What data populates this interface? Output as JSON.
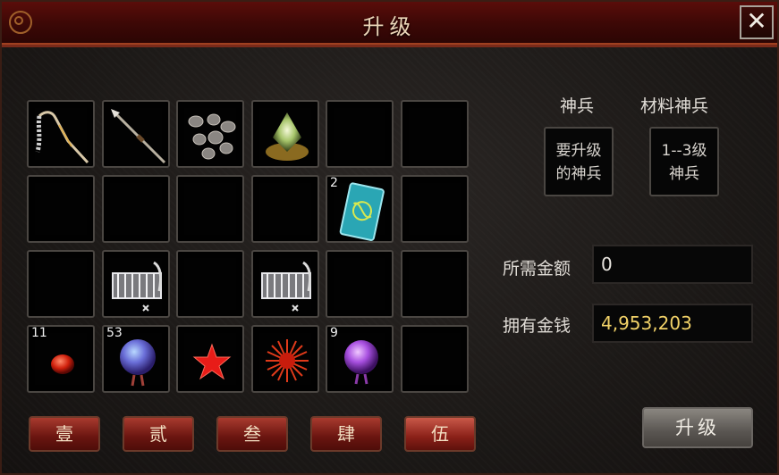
{
  "window": {
    "title": "升级",
    "close_label": "✕"
  },
  "inventory": {
    "rows": [
      [
        {
          "icon": "chain-whip-icon",
          "count": ""
        },
        {
          "icon": "spear-icon",
          "count": ""
        },
        {
          "icon": "ore-stones-icon",
          "count": ""
        },
        {
          "icon": "glowing-gem-icon",
          "count": ""
        },
        {
          "icon": "",
          "count": ""
        },
        {
          "icon": "",
          "count": ""
        }
      ],
      [
        {
          "icon": "",
          "count": ""
        },
        {
          "icon": "",
          "count": ""
        },
        {
          "icon": "",
          "count": ""
        },
        {
          "icon": "",
          "count": ""
        },
        {
          "icon": "jade-card-icon",
          "count": "2"
        },
        {
          "icon": "",
          "count": ""
        }
      ],
      [
        {
          "icon": "",
          "count": ""
        },
        {
          "icon": "armor-scroll-icon",
          "count": ""
        },
        {
          "icon": "",
          "count": ""
        },
        {
          "icon": "armor-scroll-icon",
          "count": ""
        },
        {
          "icon": "",
          "count": ""
        },
        {
          "icon": "",
          "count": ""
        }
      ],
      [
        {
          "icon": "red-bead-icon",
          "count": "11"
        },
        {
          "icon": "blue-orb-icon",
          "count": "53"
        },
        {
          "icon": "red-star-icon",
          "count": ""
        },
        {
          "icon": "red-burst-icon",
          "count": ""
        },
        {
          "icon": "purple-orb-icon",
          "count": "9"
        },
        {
          "icon": "",
          "count": ""
        }
      ]
    ]
  },
  "page_tabs": [
    "壹",
    "贰",
    "叁",
    "肆",
    "伍"
  ],
  "active_tab": 4,
  "weapon_col": {
    "label": "神兵",
    "slot_text": "要升级\n的神兵",
    "line1": "要升级",
    "line2": "的神兵"
  },
  "material_col": {
    "label": "材料神兵",
    "line1": "1--3级",
    "line2": "神兵"
  },
  "cost": {
    "label": "所需金额",
    "value": "0",
    "color": "#e8e4de"
  },
  "owned": {
    "label": "拥有金钱",
    "value": "4,953,203",
    "color": "#f2d268"
  },
  "upgrade_button": "升级"
}
